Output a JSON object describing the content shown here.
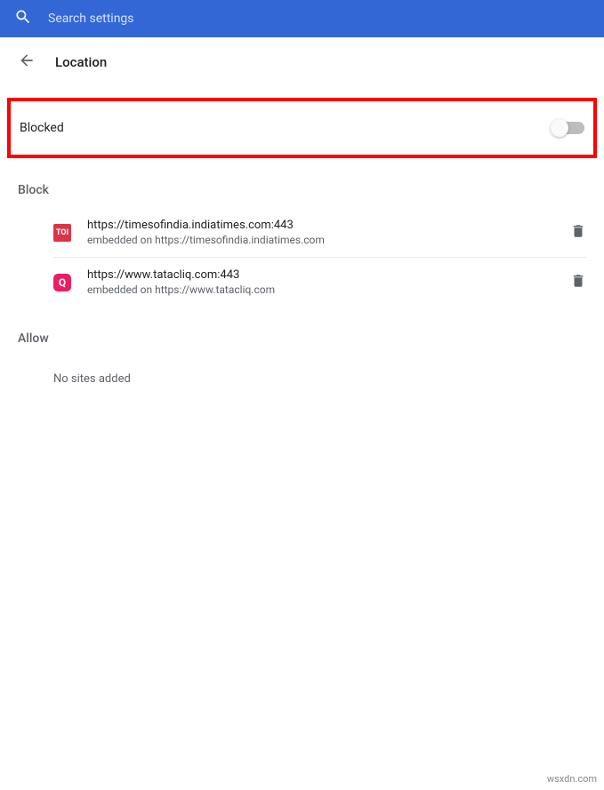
{
  "header": {
    "search_placeholder": "Search settings"
  },
  "page": {
    "title": "Location"
  },
  "toggle": {
    "label": "Blocked",
    "state": false
  },
  "sections": {
    "block_label": "Block",
    "allow_label": "Allow",
    "empty_text": "No sites added"
  },
  "block_list": [
    {
      "icon_text": "TOI",
      "url": "https://timesofindia.indiatimes.com:443",
      "embedded": "embedded on https://timesofindia.indiatimes.com"
    },
    {
      "icon_text": "Q",
      "url": "https://www.tatacliq.com:443",
      "embedded": "embedded on https://www.tatacliq.com"
    }
  ],
  "watermark": "wsxdn.com"
}
